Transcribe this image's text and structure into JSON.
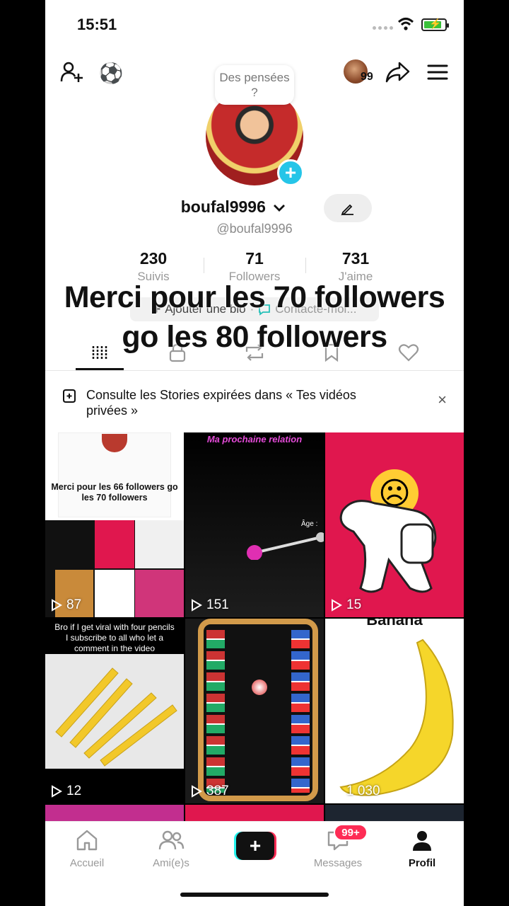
{
  "status_bar": {
    "time": "15:51"
  },
  "header": {
    "add_friend_icon": "person-plus-icon",
    "emoji": "⚽",
    "visitor_count": "99",
    "share_icon": "share-arrow-icon",
    "menu_icon": "hamburger-icon"
  },
  "profile": {
    "thought_bubble": "Des pensées ?",
    "username": "boufal9996",
    "handle": "@boufal9996",
    "stats": [
      {
        "value": "230",
        "label": "Suivis"
      },
      {
        "value": "71",
        "label": "Followers"
      },
      {
        "value": "731",
        "label": "J'aime"
      }
    ],
    "add_bio": "Ajouter une bio",
    "bio_separator": "·",
    "contact": "Contacte-moi..."
  },
  "overlay_caption": "Merci pour les 70 followers go les 80 followers",
  "tabs": [
    "videos",
    "private",
    "reposts",
    "favorites",
    "liked"
  ],
  "stories_banner": {
    "text": "Consulte les Stories expirées dans « Tes vidéos privées »",
    "close": "×"
  },
  "videos": [
    {
      "views": "87",
      "caption": "Merci pour les 66 followers go les 70 followers",
      "bg": "#ffffff"
    },
    {
      "views": "151",
      "caption": "Ma prochaine relation",
      "sub": "Âge :",
      "bg": "#111111"
    },
    {
      "views": "15",
      "caption": "",
      "bg": "#e0174e"
    },
    {
      "views": "12",
      "caption": "Bro if I get viral with four pencils I subscribe to all who let a comment in the video",
      "bg": "#000000"
    },
    {
      "views": "387",
      "caption": "",
      "bg": "#1a1a1a"
    },
    {
      "views": "1 030",
      "caption": "Banana",
      "bg": "#ffffff"
    }
  ],
  "bottom_nav": [
    {
      "label": "Accueil",
      "icon": "home-icon"
    },
    {
      "label": "Ami(e)s",
      "icon": "friends-icon"
    },
    {
      "label": "+",
      "icon": "create-icon"
    },
    {
      "label": "Messages",
      "icon": "inbox-icon",
      "badge": "99+"
    },
    {
      "label": "Profil",
      "icon": "profile-icon"
    }
  ]
}
